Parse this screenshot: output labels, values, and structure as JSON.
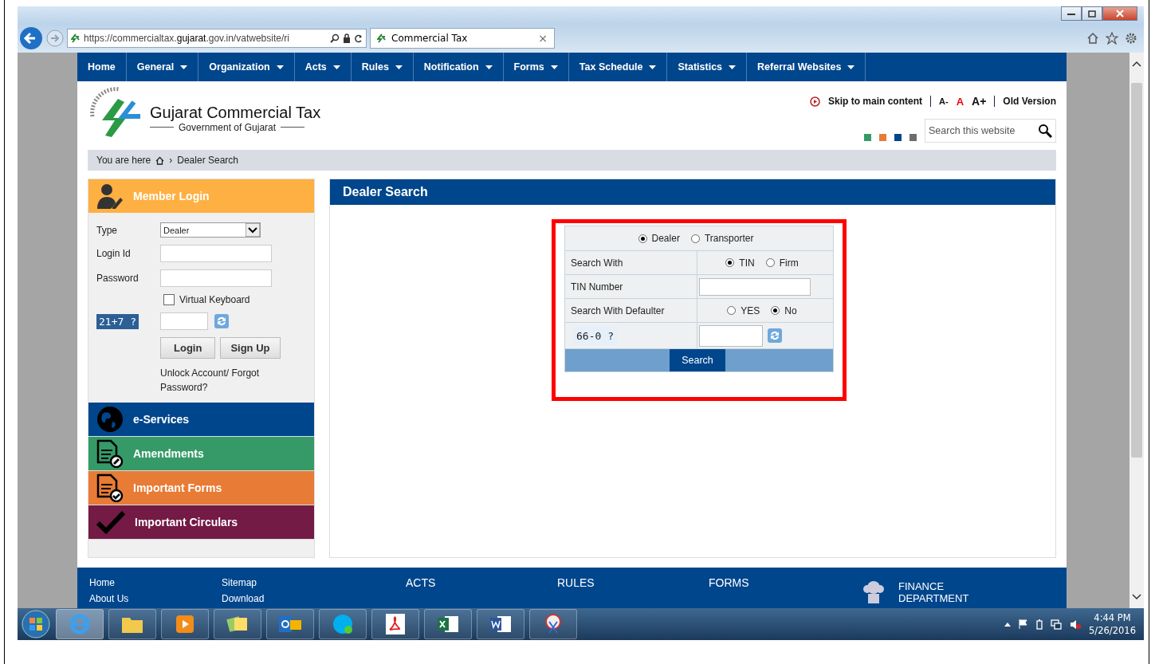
{
  "browser": {
    "address": "https://commercialtax.**gujarat**.gov.in/vatwebsite/ri",
    "tab_title": "Commercial Tax",
    "tab_close": "×"
  },
  "nav": [
    {
      "label": "Home",
      "has_menu": false
    },
    {
      "label": "General",
      "has_menu": true
    },
    {
      "label": "Organization",
      "has_menu": true
    },
    {
      "label": "Acts",
      "has_menu": true
    },
    {
      "label": "Rules",
      "has_menu": true
    },
    {
      "label": "Notification",
      "has_menu": true
    },
    {
      "label": "Forms",
      "has_menu": true
    },
    {
      "label": "Tax Schedule",
      "has_menu": true
    },
    {
      "label": "Statistics",
      "has_menu": true
    },
    {
      "label": "Referral Websites",
      "has_menu": true
    }
  ],
  "header": {
    "title": "Gujarat Commercial Tax",
    "subtitle": "Government of Gujarat",
    "skip_link": "Skip to main content",
    "font_sizes": [
      {
        "label": "A-",
        "kind": "small"
      },
      {
        "label": "A",
        "kind": "normal"
      },
      {
        "label": "A+",
        "kind": "large"
      }
    ],
    "old_version": "Old Version",
    "search": {
      "placeholder": "Search this website"
    },
    "themes": [
      {
        "color": "#359a68"
      },
      {
        "color": "#e87b35"
      },
      {
        "color": "#00468c"
      },
      {
        "color": "#6d6d6d"
      }
    ]
  },
  "breadcrumb": {
    "label": "You are here",
    "separator": "›",
    "current": "Dealer Search"
  },
  "login": {
    "title": "Member Login",
    "type_label": "Type",
    "type_value": "Dealer",
    "login_label": "Login Id",
    "password_label": "Password",
    "virtual_keyboard": {
      "label": "Virtual Keyboard",
      "checked": false
    },
    "captcha": "21+7 ?",
    "buttons": [
      "Login",
      "Sign Up"
    ],
    "forgot_link": "Unlock Account/ Forgot Password?"
  },
  "sidebar_menu": [
    {
      "label": "e-Services",
      "color": "#00468c",
      "kind": "globe"
    },
    {
      "label": "Amendments",
      "color": "#359a68",
      "kind": "doc-edit"
    },
    {
      "label": "Important Forms",
      "color": "#e87b35",
      "kind": "doc-check"
    },
    {
      "label": "Important Circulars",
      "color": "#731a45",
      "kind": "check"
    }
  ],
  "dealer_search": {
    "title": "Dealer Search",
    "modes": [
      {
        "label": "Dealer",
        "selected": true
      },
      {
        "label": "Transporter",
        "selected": false
      }
    ],
    "rows": [
      {
        "kind": "radio",
        "label": "Search With",
        "options": [
          {
            "label": "TIN",
            "selected": true
          },
          {
            "label": "Firm",
            "selected": false
          }
        ]
      },
      {
        "kind": "input",
        "label": "TIN Number"
      },
      {
        "kind": "radio",
        "label": "Search With Defaulter",
        "options": [
          {
            "label": "YES",
            "selected": false
          },
          {
            "label": "No",
            "selected": true
          }
        ]
      },
      {
        "kind": "captcha",
        "captcha": "66-0 ?"
      }
    ],
    "search_button": "Search"
  },
  "footer": {
    "links_1": [
      "Home",
      "About Us"
    ],
    "links_2": [
      "Sitemap",
      "Download"
    ],
    "headings": [
      "ACTS",
      "RULES",
      "FORMS"
    ],
    "department": [
      "FINANCE",
      "DEPARTMENT"
    ]
  },
  "taskbar": {
    "time": "4:44 PM",
    "date": "5/26/2016"
  }
}
